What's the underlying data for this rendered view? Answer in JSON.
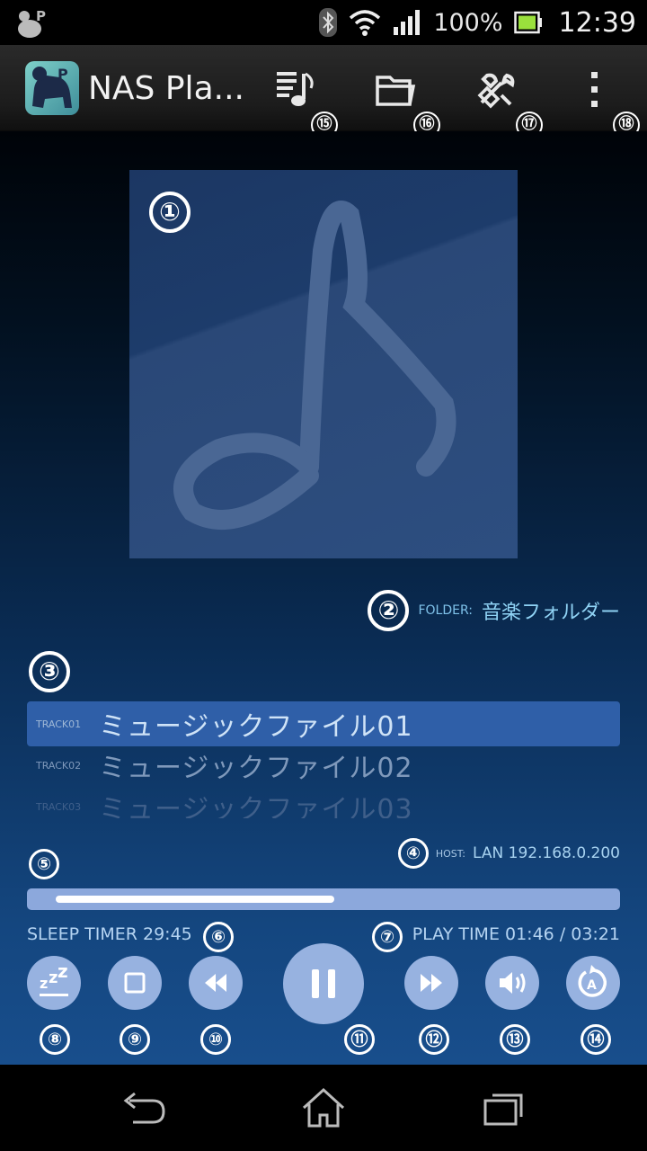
{
  "status_bar": {
    "battery": "100%",
    "time": "12:39",
    "icons": [
      "app-notification-icon",
      "bluetooth-icon",
      "wifi-icon",
      "signal-icon",
      "battery-icon"
    ]
  },
  "action_bar": {
    "title": "NAS Pla...",
    "buttons": [
      {
        "name": "playlist-icon",
        "marker": "⑮"
      },
      {
        "name": "folder-icon",
        "marker": "⑯"
      },
      {
        "name": "tools-icon",
        "marker": "⑰"
      },
      {
        "name": "overflow-menu-icon",
        "marker": "⑱"
      }
    ]
  },
  "markers": {
    "artwork": "①",
    "folder": "②",
    "tracklist": "③",
    "host": "④",
    "progress": "⑤",
    "sleep": "⑥",
    "playtime": "⑦"
  },
  "folder": {
    "label": "FOLDER:",
    "value": "音楽フォルダー"
  },
  "tracks": [
    {
      "number": "TRACK01",
      "name": "ミュージックファイル01",
      "active": true
    },
    {
      "number": "TRACK02",
      "name": "ミュージックファイル02",
      "active": false
    },
    {
      "number": "TRACK03",
      "name": "ミュージックファイル03",
      "active": false
    }
  ],
  "host": {
    "label": "HOST:",
    "value": "LAN 192.168.0.200"
  },
  "progress": {
    "fraction": 0.52
  },
  "sleep_timer": "SLEEP TIMER 29:45",
  "play_time": "PLAY TIME 01:46 / 03:21",
  "controls": [
    {
      "name": "sleep-timer-icon",
      "marker": "⑧"
    },
    {
      "name": "stop-icon",
      "marker": "⑨"
    },
    {
      "name": "rewind-icon",
      "marker": "⑩"
    },
    {
      "name": "pause-icon",
      "marker": "⑪"
    },
    {
      "name": "fast-forward-icon",
      "marker": "⑫"
    },
    {
      "name": "volume-icon",
      "marker": "⑬"
    },
    {
      "name": "auto-repeat-icon",
      "marker": "⑭"
    }
  ],
  "nav_bar": [
    "back-icon",
    "home-icon",
    "recent-apps-icon"
  ],
  "colors": {
    "accent": "#8fd2f4",
    "control_bg": "#97b2e0",
    "active_track": "#2f5fa8"
  }
}
